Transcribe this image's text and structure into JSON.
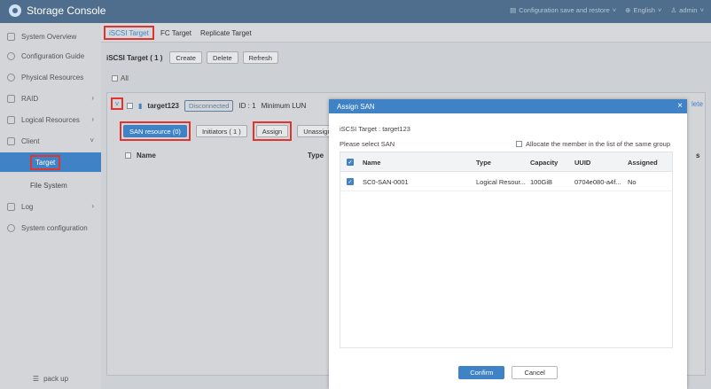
{
  "app": {
    "title": "Storage Console"
  },
  "topbar": {
    "config_label": "Configuration save and restore",
    "language": "English",
    "user": "admin"
  },
  "sidebar": {
    "items": [
      {
        "label": "System Overview",
        "icon": "grid-icon"
      },
      {
        "label": "Configuration Guide",
        "icon": "compass-icon"
      },
      {
        "label": "Physical Resources",
        "icon": "disk-icon"
      },
      {
        "label": "RAID",
        "icon": "raid-icon"
      },
      {
        "label": "Logical Resources",
        "icon": "volume-icon"
      },
      {
        "label": "Client",
        "icon": "client-icon"
      },
      {
        "label": "Log",
        "icon": "log-icon"
      },
      {
        "label": "System configuration",
        "icon": "gear-icon"
      }
    ],
    "sub_items": [
      {
        "label": "Target"
      },
      {
        "label": "File System"
      }
    ],
    "pack_up": "pack up"
  },
  "main": {
    "tabs": [
      {
        "label": "iSCSI Target"
      },
      {
        "label": "FC Target"
      },
      {
        "label": "Replicate Target"
      }
    ],
    "toolbar": {
      "label": "iSCSI Target ( 1 )",
      "create": "Create",
      "delete": "Delete",
      "refresh": "Refresh"
    },
    "all_label": "All",
    "target": {
      "name": "target123",
      "status": "Disconnected",
      "id": "ID : 1",
      "min_lun": "Minimum LUN",
      "delete_link": "lete"
    },
    "sub_toolbar": {
      "san_resource": "SAN resource (0)",
      "initiators": "Initiators ( 1 )",
      "assign": "Assign",
      "unassign": "Unassign"
    },
    "columns": {
      "name": "Name",
      "type": "Type",
      "right_suffix": "s"
    }
  },
  "modal": {
    "title": "Assign SAN",
    "target_info": "iSCSI Target : target123",
    "select_label": "Please select SAN",
    "allocate_label": "Allocate the member in the list of the same group",
    "headers": {
      "name": "Name",
      "type": "Type",
      "capacity": "Capacity",
      "uuid": "UUID",
      "assigned": "Assigned"
    },
    "rows": [
      {
        "name": "SC0-SAN-0001",
        "type": "Logical Resour...",
        "capacity": "100GiB",
        "uuid": "0704e080-a4f...",
        "assigned": "No"
      }
    ],
    "confirm": "Confirm",
    "cancel": "Cancel"
  },
  "colors": {
    "accent": "#3f83c6",
    "topbar": "#4f6d8c",
    "highlight": "#e0342e"
  }
}
